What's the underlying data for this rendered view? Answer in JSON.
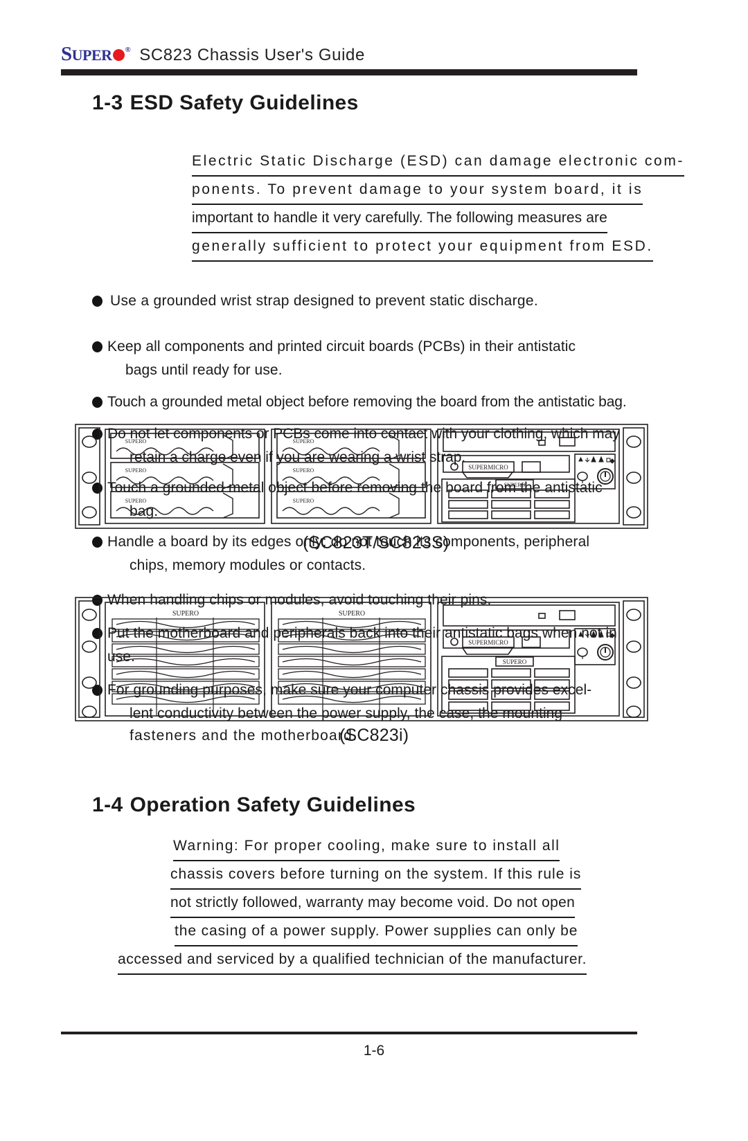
{
  "header": {
    "logo_super": "SUPER",
    "logo_s": "S",
    "logo_uper": "UPER",
    "logo_registered": "®",
    "title": "SC823 Chassis User's Guide"
  },
  "sections": {
    "esd": {
      "number": "1-3",
      "title": "ESD Safety Guidelines",
      "intro_lines": [
        "Electric Static Discharge (ESD) can damage electronic com-",
        "ponents.  To prevent damage to your system board, it is",
        "important to handle it very carefully.  The following measures are",
        "generally sufficient to protect your equipment from ESD."
      ]
    },
    "operation": {
      "number": "1-4",
      "title": "Operation Safety Guidelines",
      "warning_lines": [
        "Warning:  For proper cooling, make sure to install all",
        "chassis covers before turning on the system.  If this rule is",
        "not strictly followed, warranty may become void. Do not open",
        "the casing of a power supply.  Power supplies can only be",
        "accessed and serviced by a qualified technician of the manufacturer."
      ]
    }
  },
  "bullets": [
    {
      "line1": "Use a grounded wrist strap designed to prevent static discharge.",
      "line2": ""
    },
    {
      "line1": "Keep all components and printed circuit boards (PCBs) in their antistatic",
      "line2": "bags until ready for use."
    },
    {
      "line1": "Touch a grounded metal object before removing the board from the antistatic bag.",
      "line2": ""
    },
    {
      "line1": "Do not let components or PCBs come into contact with your clothing, which may",
      "line2": "retain a charge even if you are wearing a wrist strap."
    },
    {
      "line1": "Touch a grounded metal object before removing the board from the antistatic",
      "line2": "bag."
    },
    {
      "line1": "Handle a board by its edges only; do not touch its components, peripheral",
      "line2": "chips, memory modules or contacts."
    },
    {
      "line1": "When handling chips or modules, avoid touching their pins.",
      "line2": ""
    },
    {
      "line1": "Put the motherboard and peripherals back into their antistatic bags when not in",
      "line2": "use."
    },
    {
      "line1": "For grounding purposes, make sure your computer chassis provides excel-",
      "line2": "lent conductivity between the power supply, the case, the mounting"
    },
    {
      "line1": "fasteners and the motherboard.",
      "line2": ""
    }
  ],
  "figures": [
    {
      "caption": "(SC823T/SC823S)",
      "bay_label": "SUPERO",
      "panel_brand": "SUPERMICRO",
      "mb_label": "SUPERO"
    },
    {
      "caption": "(SC823i)",
      "bay_label": "SUPERO",
      "panel_brand": "SUPERMICRO",
      "mb_label": "SUPERO"
    }
  ],
  "footer": {
    "page_number": "1-6"
  },
  "colors": {
    "logo_blue": "#2e3192",
    "logo_red": "#e8191d",
    "rule_dark": "#231f20",
    "text": "#1a1a1a"
  }
}
